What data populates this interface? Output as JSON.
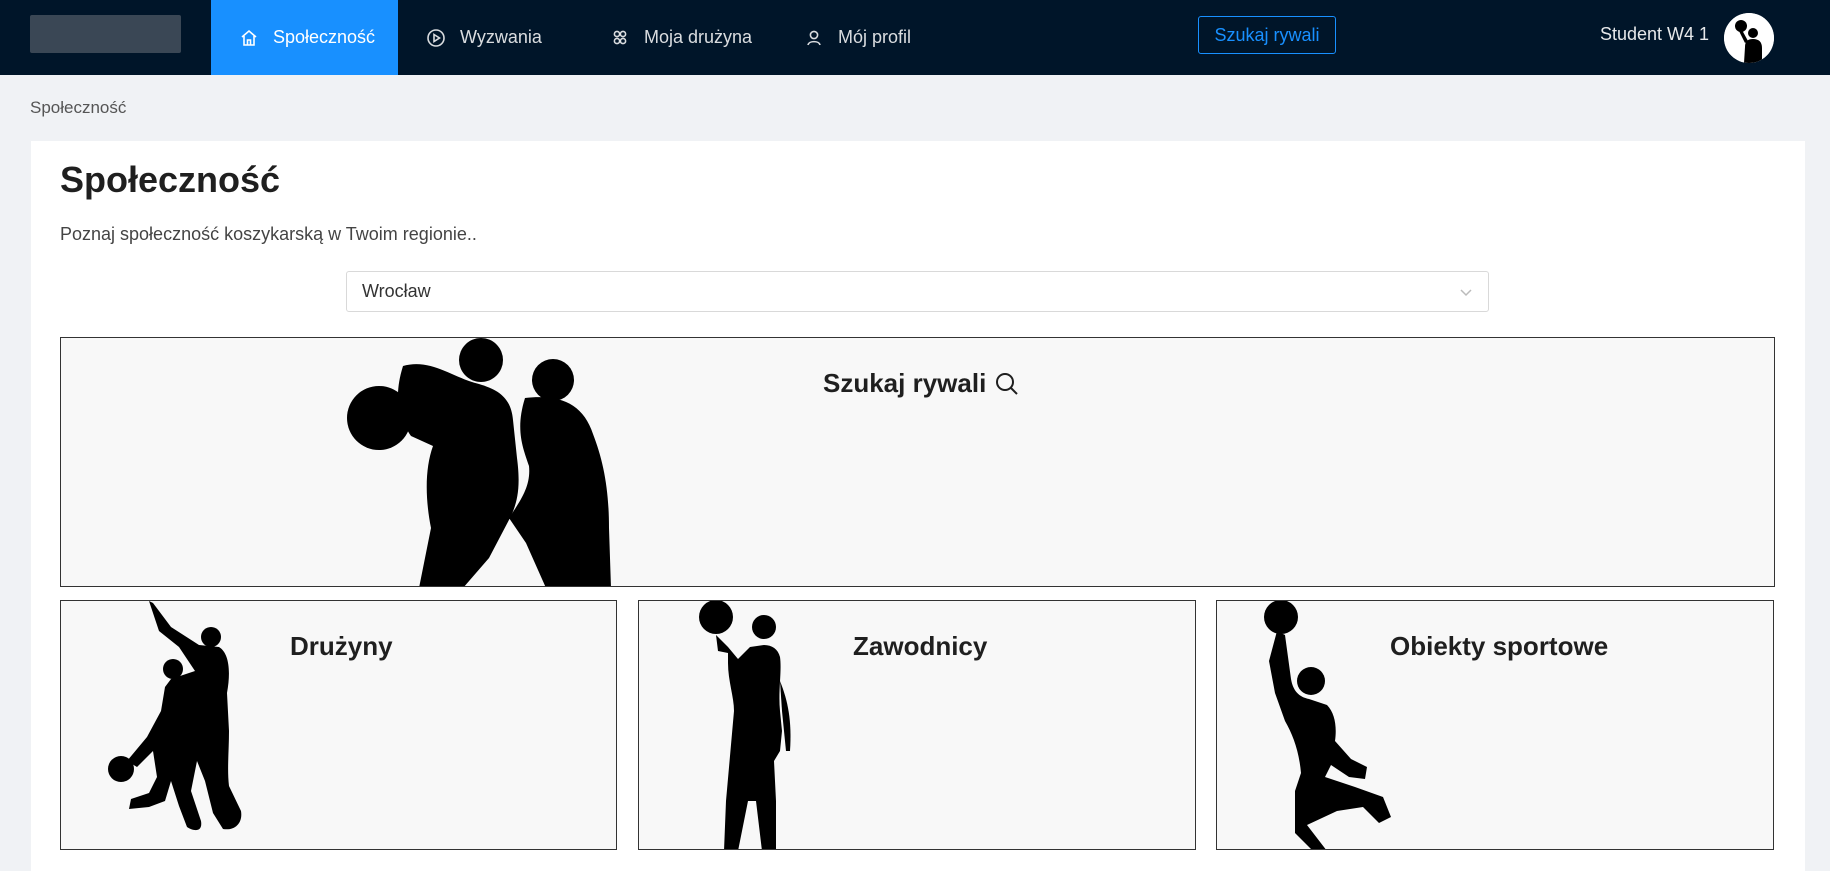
{
  "nav": {
    "items": [
      {
        "label": "Społeczność",
        "icon": "home-icon",
        "active": true
      },
      {
        "label": "Wyzwania",
        "icon": "play-circle-icon",
        "active": false
      },
      {
        "label": "Moja drużyna",
        "icon": "team-icon",
        "active": false
      },
      {
        "label": "Mój profil",
        "icon": "user-icon",
        "active": false
      }
    ],
    "cta_label": "Szukaj rywali",
    "user_name": "Student W4 1"
  },
  "breadcrumb": "Społeczność",
  "page": {
    "title": "Społeczność",
    "subtitle": "Poznaj społeczność koszykarską w Twoim regionie..",
    "region_select_value": "Wrocław"
  },
  "tiles": {
    "main": {
      "label": "Szukaj rywali",
      "icon": "search-icon"
    },
    "teams": {
      "label": "Drużyny"
    },
    "players": {
      "label": "Zawodnicy"
    },
    "venues": {
      "label": "Obiekty sportowe"
    }
  },
  "colors": {
    "topbar": "#001529",
    "accent": "#1890ff",
    "page_bg": "#f0f2f5"
  }
}
